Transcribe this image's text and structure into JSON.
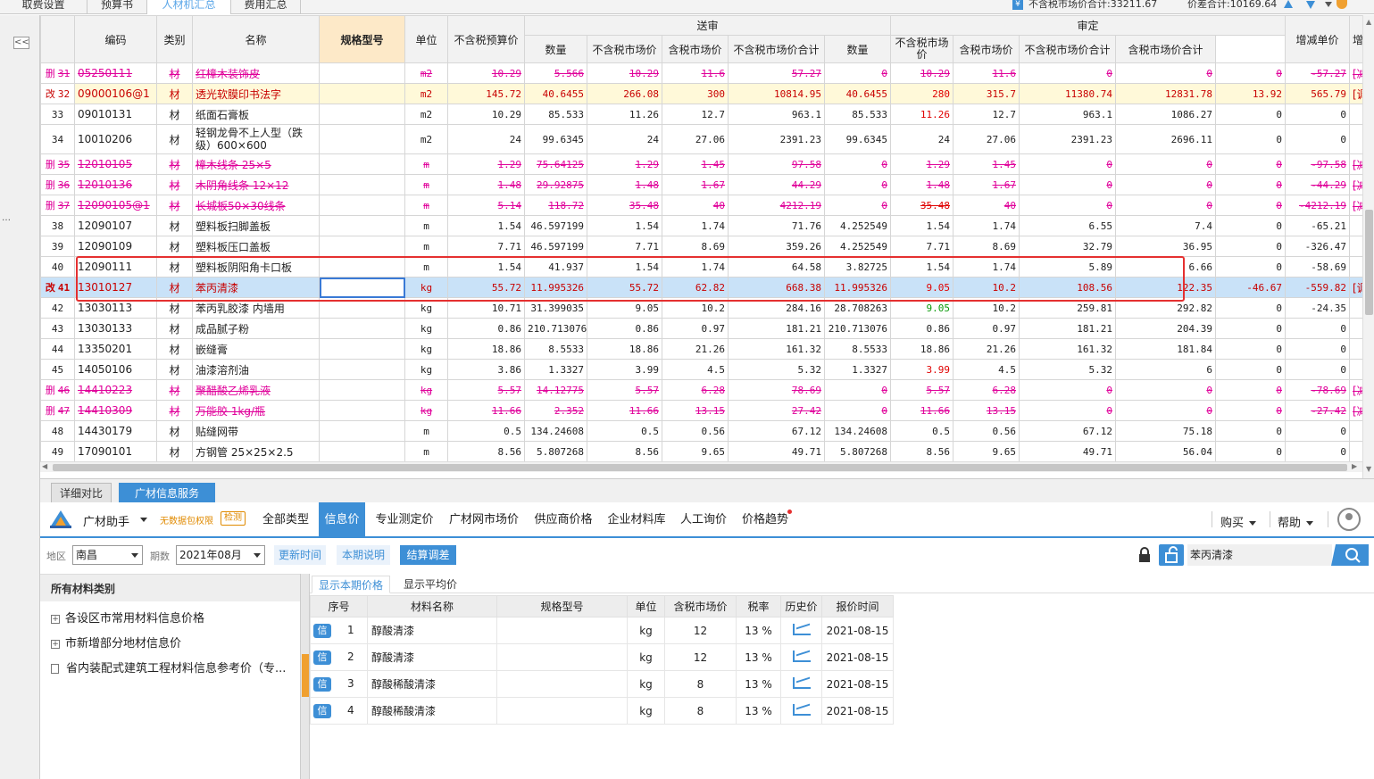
{
  "top_tabs": [
    "取费设置",
    "预算书",
    "人材机汇总",
    "费用汇总"
  ],
  "top_summary": {
    "icon": "¥",
    "tax_excl_total": "不含税市场价合计:33211.67",
    "diff_total": "价差合计:10169.64"
  },
  "collapse_label": "<<",
  "left_dots": "…",
  "grid": {
    "headers": {
      "code": "编码",
      "category": "类别",
      "name": "名称",
      "spec": "规格型号",
      "unit": "单位",
      "budget_price": "不含税预算价",
      "submit_group": "送审",
      "review_group": "审定",
      "qty": "数量",
      "market_excl": "不含税市场价",
      "market_incl": "含税市场价",
      "market_excl_total": "不含税市场价合计",
      "market_incl_total": "含税市场价合计",
      "inc_unit": "增减单价",
      "inc_amount": "增减金额",
      "extra": "增"
    },
    "rows": [
      {
        "type": "del",
        "mark": "删",
        "seq": "31",
        "code": "05250111",
        "cat": "材",
        "name": "红樟木装饰皮",
        "spec": "",
        "unit": "m2",
        "budget": "10.29",
        "s_qty": "5.566",
        "s_excl": "10.29",
        "s_incl": "11.6",
        "s_total": "57.27",
        "r_qty": "0",
        "r_excl": "10.29",
        "r_incl": "11.6",
        "r_total": "0",
        "r_incl_total": "0",
        "inc_unit": "0",
        "inc_amt": "-57.27",
        "extra": "[减"
      },
      {
        "type": "mod",
        "mark": "改",
        "seq": "32",
        "code": "09000106@1",
        "cat": "材",
        "name": "透光软膜印书法字",
        "spec": "",
        "unit": "m2",
        "budget": "145.72",
        "s_qty": "40.6455",
        "s_excl": "266.08",
        "s_incl": "300",
        "s_total": "10814.95",
        "r_qty": "40.6455",
        "r_excl": "280",
        "r_incl": "315.7",
        "r_total": "11380.74",
        "r_incl_total": "12831.78",
        "inc_unit": "13.92",
        "inc_amt": "565.79",
        "extra": "[调"
      },
      {
        "type": "norm",
        "mark": "",
        "seq": "33",
        "code": "09010131",
        "cat": "材",
        "name": "纸面石膏板",
        "spec": "",
        "unit": "m2",
        "budget": "10.29",
        "s_qty": "85.533",
        "s_excl": "11.26",
        "s_incl": "12.7",
        "s_total": "963.1",
        "r_qty": "85.533",
        "r_excl": "11.26",
        "r_incl": "12.7",
        "r_total": "963.1",
        "r_incl_total": "1086.27",
        "inc_unit": "0",
        "inc_amt": "0",
        "extra": ""
      },
      {
        "type": "tall",
        "mark": "",
        "seq": "34",
        "code": "10010206",
        "cat": "材",
        "name": "轻钢龙骨不上人型（跌级）600×600",
        "spec": "",
        "unit": "m2",
        "budget": "24",
        "s_qty": "99.6345",
        "s_excl": "24",
        "s_incl": "27.06",
        "s_total": "2391.23",
        "r_qty": "99.6345",
        "r_excl": "24",
        "r_incl": "27.06",
        "r_total": "2391.23",
        "r_incl_total": "2696.11",
        "inc_unit": "0",
        "inc_amt": "0",
        "extra": ""
      },
      {
        "type": "del",
        "mark": "删",
        "seq": "35",
        "code": "12010105",
        "cat": "材",
        "name": "樟木线条 25×5",
        "spec": "",
        "unit": "m",
        "budget": "1.29",
        "s_qty": "75.64125",
        "s_excl": "1.29",
        "s_incl": "1.45",
        "s_total": "97.58",
        "r_qty": "0",
        "r_excl": "1.29",
        "r_incl": "1.45",
        "r_total": "0",
        "r_incl_total": "0",
        "inc_unit": "0",
        "inc_amt": "-97.58",
        "extra": "[减"
      },
      {
        "type": "del",
        "mark": "删",
        "seq": "36",
        "code": "12010136",
        "cat": "材",
        "name": "木阴角线条 12×12",
        "spec": "",
        "unit": "m",
        "budget": "1.48",
        "s_qty": "29.92875",
        "s_excl": "1.48",
        "s_incl": "1.67",
        "s_total": "44.29",
        "r_qty": "0",
        "r_excl": "1.48",
        "r_incl": "1.67",
        "r_total": "0",
        "r_incl_total": "0",
        "inc_unit": "0",
        "inc_amt": "-44.29",
        "extra": "[减"
      },
      {
        "type": "del",
        "mark": "删",
        "seq": "37",
        "code": "12090105@1",
        "cat": "材",
        "name": "长城板50×30线条",
        "spec": "",
        "unit": "m",
        "budget": "5.14",
        "s_qty": "118.72",
        "s_excl": "35.48",
        "s_incl": "40",
        "s_total": "4212.19",
        "r_qty": "0",
        "r_excl": "35.48",
        "r_incl": "40",
        "r_total": "0",
        "r_incl_total": "0",
        "inc_unit": "0",
        "inc_amt": "-4212.19",
        "extra": "[减"
      },
      {
        "type": "norm",
        "mark": "",
        "seq": "38",
        "code": "12090107",
        "cat": "材",
        "name": "塑料板扫脚盖板",
        "spec": "",
        "unit": "m",
        "budget": "1.54",
        "s_qty": "46.597199",
        "s_excl": "1.54",
        "s_incl": "1.74",
        "s_total": "71.76",
        "r_qty": "4.252549",
        "r_excl": "1.54",
        "r_incl": "1.74",
        "r_total": "6.55",
        "r_incl_total": "7.4",
        "inc_unit": "0",
        "inc_amt": "-65.21",
        "extra": ""
      },
      {
        "type": "norm",
        "mark": "",
        "seq": "39",
        "code": "12090109",
        "cat": "材",
        "name": "塑料板压口盖板",
        "spec": "",
        "unit": "m",
        "budget": "7.71",
        "s_qty": "46.597199",
        "s_excl": "7.71",
        "s_incl": "8.69",
        "s_total": "359.26",
        "r_qty": "4.252549",
        "r_excl": "7.71",
        "r_incl": "8.69",
        "r_total": "32.79",
        "r_incl_total": "36.95",
        "inc_unit": "0",
        "inc_amt": "-326.47",
        "extra": ""
      },
      {
        "type": "norm",
        "mark": "",
        "seq": "40",
        "code": "12090111",
        "cat": "材",
        "name": "塑料板阴阳角卡口板",
        "spec": "",
        "unit": "m",
        "budget": "1.54",
        "s_qty": "41.937",
        "s_excl": "1.54",
        "s_incl": "1.74",
        "s_total": "64.58",
        "r_qty": "3.82725",
        "r_excl": "1.54",
        "r_incl": "1.74",
        "r_total": "5.89",
        "r_incl_total": "6.66",
        "inc_unit": "0",
        "inc_amt": "-58.69",
        "extra": ""
      },
      {
        "type": "sel",
        "mark": "改",
        "seq": "41",
        "code": "13010127",
        "cat": "材",
        "name": "苯丙清漆",
        "spec": "",
        "unit": "kg",
        "budget": "55.72",
        "s_qty": "11.995326",
        "s_excl": "55.72",
        "s_incl": "62.82",
        "s_total": "668.38",
        "r_qty": "11.995326",
        "r_excl": "9.05",
        "r_incl": "10.2",
        "r_total": "108.56",
        "r_incl_total": "122.35",
        "inc_unit": "-46.67",
        "inc_amt": "-559.82",
        "extra": "[调"
      },
      {
        "type": "norm",
        "mark": "",
        "seq": "42",
        "code": "13030113",
        "cat": "材",
        "name": "苯丙乳胶漆 内墙用",
        "spec": "",
        "unit": "kg",
        "budget": "10.71",
        "s_qty": "31.399035",
        "s_excl": "9.05",
        "s_incl": "10.2",
        "s_total": "284.16",
        "r_qty": "28.708263",
        "r_excl": "9.05",
        "r_incl": "10.2",
        "r_total": "259.81",
        "r_incl_total": "292.82",
        "inc_unit": "0",
        "inc_amt": "-24.35",
        "extra": ""
      },
      {
        "type": "norm",
        "mark": "",
        "seq": "43",
        "code": "13030133",
        "cat": "材",
        "name": "成品腻子粉",
        "spec": "",
        "unit": "kg",
        "budget": "0.86",
        "s_qty": "210.713076",
        "s_excl": "0.86",
        "s_incl": "0.97",
        "s_total": "181.21",
        "r_qty": "210.713076",
        "r_excl": "0.86",
        "r_incl": "0.97",
        "r_total": "181.21",
        "r_incl_total": "204.39",
        "inc_unit": "0",
        "inc_amt": "0",
        "extra": ""
      },
      {
        "type": "norm",
        "mark": "",
        "seq": "44",
        "code": "13350201",
        "cat": "材",
        "name": "嵌缝膏",
        "spec": "",
        "unit": "kg",
        "budget": "18.86",
        "s_qty": "8.5533",
        "s_excl": "18.86",
        "s_incl": "21.26",
        "s_total": "161.32",
        "r_qty": "8.5533",
        "r_excl": "18.86",
        "r_incl": "21.26",
        "r_total": "161.32",
        "r_incl_total": "181.84",
        "inc_unit": "0",
        "inc_amt": "0",
        "extra": ""
      },
      {
        "type": "norm",
        "mark": "",
        "seq": "45",
        "code": "14050106",
        "cat": "材",
        "name": "油漆溶剂油",
        "spec": "",
        "unit": "kg",
        "budget": "3.86",
        "s_qty": "1.3327",
        "s_excl": "3.99",
        "s_incl": "4.5",
        "s_total": "5.32",
        "r_qty": "1.3327",
        "r_excl": "3.99",
        "r_incl": "4.5",
        "r_total": "5.32",
        "r_incl_total": "6",
        "inc_unit": "0",
        "inc_amt": "0",
        "extra": ""
      },
      {
        "type": "del",
        "mark": "删",
        "seq": "46",
        "code": "14410223",
        "cat": "材",
        "name": "聚醋酸乙烯乳液",
        "spec": "",
        "unit": "kg",
        "budget": "5.57",
        "s_qty": "14.12775",
        "s_excl": "5.57",
        "s_incl": "6.28",
        "s_total": "78.69",
        "r_qty": "0",
        "r_excl": "5.57",
        "r_incl": "6.28",
        "r_total": "0",
        "r_incl_total": "0",
        "inc_unit": "0",
        "inc_amt": "-78.69",
        "extra": "[减"
      },
      {
        "type": "del",
        "mark": "删",
        "seq": "47",
        "code": "14410309",
        "cat": "材",
        "name": "万能胶 1kg/瓶",
        "spec": "",
        "unit": "kg",
        "budget": "11.66",
        "s_qty": "2.352",
        "s_excl": "11.66",
        "s_incl": "13.15",
        "s_total": "27.42",
        "r_qty": "0",
        "r_excl": "11.66",
        "r_incl": "13.15",
        "r_total": "0",
        "r_incl_total": "0",
        "inc_unit": "0",
        "inc_amt": "-27.42",
        "extra": "[减"
      },
      {
        "type": "norm",
        "mark": "",
        "seq": "48",
        "code": "14430179",
        "cat": "材",
        "name": "贴缝网带",
        "spec": "",
        "unit": "m",
        "budget": "0.5",
        "s_qty": "134.24608",
        "s_excl": "0.5",
        "s_incl": "0.56",
        "s_total": "67.12",
        "r_qty": "134.24608",
        "r_excl": "0.5",
        "r_incl": "0.56",
        "r_total": "67.12",
        "r_incl_total": "75.18",
        "inc_unit": "0",
        "inc_amt": "0",
        "extra": ""
      },
      {
        "type": "norm",
        "mark": "",
        "seq": "49",
        "code": "17090101",
        "cat": "材",
        "name": "方钢管 25×25×2.5",
        "spec": "",
        "unit": "m",
        "budget": "8.56",
        "s_qty": "5.807268",
        "s_excl": "8.56",
        "s_incl": "9.65",
        "s_total": "49.71",
        "r_qty": "5.807268",
        "r_excl": "8.56",
        "r_incl": "9.65",
        "r_total": "49.71",
        "r_incl_total": "56.04",
        "inc_unit": "0",
        "inc_amt": "0",
        "extra": ""
      }
    ]
  },
  "bottom_tabs": [
    "详细对比",
    "广材信息服务"
  ],
  "toolbar": {
    "assistant": "广材助手",
    "no_data": "无数据包权限",
    "check": "检测",
    "nav": [
      "全部类型",
      "信息价",
      "专业测定价",
      "广材网市场价",
      "供应商价格",
      "企业材料库",
      "人工询价",
      "价格趋势"
    ],
    "buy": "购买",
    "help": "帮助"
  },
  "filters": {
    "region_label": "地区",
    "region_value": "南昌",
    "period_label": "期数",
    "period_value": "2021年08月",
    "update_time": "更新时间",
    "period_note": "本期说明",
    "settle_adjust": "结算调差",
    "search_value": "苯丙清漆"
  },
  "category_panel": {
    "title": "所有材料类别",
    "items": [
      "各设区市常用材料信息价格",
      "市新增部分地材信息价",
      "省内装配式建筑工程材料信息参考价（专..."
    ]
  },
  "sub_tabs": [
    "显示本期价格",
    "显示平均价"
  ],
  "price_table": {
    "headers": [
      "序号",
      "材料名称",
      "规格型号",
      "单位",
      "含税市场价",
      "税率",
      "历史价",
      "报价时间"
    ],
    "badge": "信",
    "rows": [
      {
        "no": "1",
        "name": "醇酸清漆",
        "spec": "",
        "unit": "kg",
        "price": "12",
        "tax": "13 %",
        "date": "2021-08-15"
      },
      {
        "no": "2",
        "name": "醇酸清漆",
        "spec": "",
        "unit": "kg",
        "price": "12",
        "tax": "13 %",
        "date": "2021-08-15"
      },
      {
        "no": "3",
        "name": "醇酸稀酸清漆",
        "spec": "",
        "unit": "kg",
        "price": "8",
        "tax": "13 %",
        "date": "2021-08-15"
      },
      {
        "no": "4",
        "name": "醇酸稀酸清漆",
        "spec": "",
        "unit": "kg",
        "price": "8",
        "tax": "13 %",
        "date": "2021-08-15"
      }
    ]
  },
  "colors": {
    "accent": "#3d8fd6",
    "deleted_row": "#e0009a",
    "modified_row_bg": "#fff9d9",
    "selected_row_bg": "#c9e2f8",
    "highlight_red": "#e53030",
    "orange": "#f0a030"
  }
}
